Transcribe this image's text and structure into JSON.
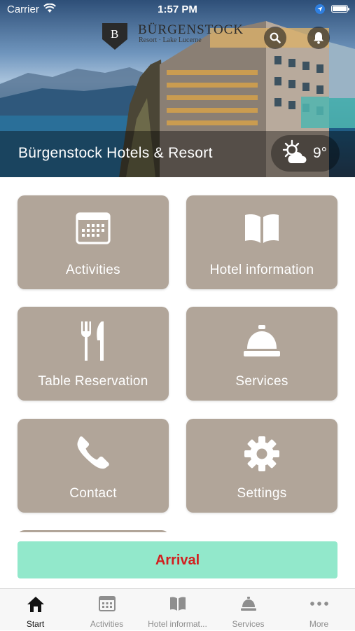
{
  "status_bar": {
    "carrier": "Carrier",
    "time": "1:57 PM"
  },
  "header": {
    "logo_letter": "B",
    "logo_name": "BÜRGENSTOCK",
    "logo_subtitle": "Resort · Lake Lucerne",
    "title": "Bürgenstock Hotels & Resort",
    "weather": {
      "temperature": "9°",
      "icon": "partly-cloudy-icon"
    }
  },
  "tiles": [
    {
      "label": "Activities",
      "icon": "calendar-icon"
    },
    {
      "label": "Hotel information",
      "icon": "book-icon"
    },
    {
      "label": "Table Reservation",
      "icon": "cutlery-icon"
    },
    {
      "label": "Services",
      "icon": "service-bell-icon"
    },
    {
      "label": "Contact",
      "icon": "phone-icon"
    },
    {
      "label": "Settings",
      "icon": "gear-icon"
    }
  ],
  "arrival_button": "Arrival",
  "tab_bar": [
    {
      "label": "Start",
      "icon": "home-icon",
      "active": true
    },
    {
      "label": "Activities",
      "icon": "calendar-icon",
      "active": false
    },
    {
      "label": "Hotel informat...",
      "icon": "book-icon",
      "active": false
    },
    {
      "label": "Services",
      "icon": "service-bell-icon",
      "active": false
    },
    {
      "label": "More",
      "icon": "more-icon",
      "active": false
    }
  ],
  "colors": {
    "tile_background": "#b1a599",
    "arrival_background": "#92e8cb",
    "arrival_text": "#d21f1f",
    "tab_active": "#111111",
    "tab_inactive": "#8e8e8e"
  }
}
